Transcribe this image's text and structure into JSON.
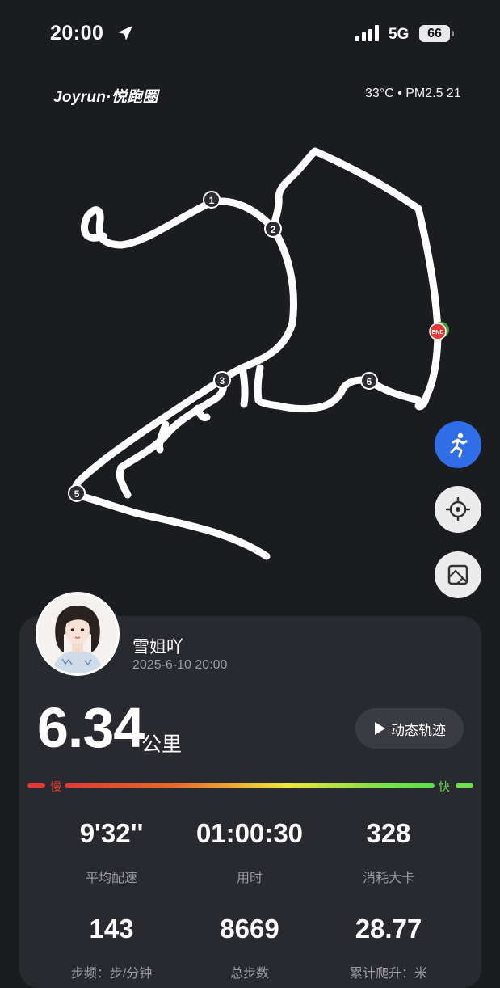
{
  "status_bar": {
    "time": "20:00",
    "network": "5G",
    "battery": "66"
  },
  "header": {
    "brand": "Joyrun·悦跑圈",
    "weather": "33°C • PM2.5 21"
  },
  "map": {
    "markers": [
      "1",
      "2",
      "3",
      "5",
      "6"
    ],
    "end_label": "END",
    "colors": {
      "route": "#ffffff",
      "end": "#e53935",
      "start": "#43a047"
    }
  },
  "buttons": {
    "run_mode_icon": "runner-icon",
    "locate_icon": "crosshair-icon",
    "layer_icon": "map-layer-icon"
  },
  "profile": {
    "username": "雪姐吖",
    "datetime": "2025-6-10 20:00"
  },
  "summary": {
    "distance": "6.34",
    "unit": "公里",
    "replay_label": "动态轨迹"
  },
  "pace_legend": {
    "slow": "慢",
    "fast": "快"
  },
  "stats": [
    {
      "value": "9'32''",
      "label": "平均配速"
    },
    {
      "value": "01:00:30",
      "label": "用时"
    },
    {
      "value": "328",
      "label": "消耗大卡"
    },
    {
      "value": "143",
      "label": "步频：步/分钟"
    },
    {
      "value": "8669",
      "label": "总步数"
    },
    {
      "value": "28.77",
      "label": "累计爬升：米"
    }
  ]
}
